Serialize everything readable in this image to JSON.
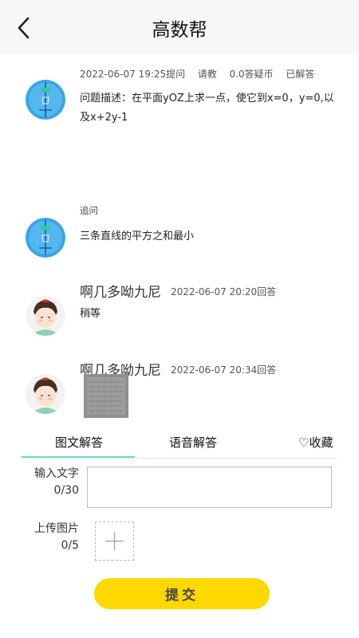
{
  "header": {
    "title": "高数帮"
  },
  "question": {
    "meta_time": "2022-06-07 19:25提问",
    "meta_ask": "请教",
    "meta_coin": "0.0答疑币",
    "meta_status": "已解答",
    "text": "问题描述：在平面yOZ上求一点，使它到x=0，y=0,以及x+2y-1"
  },
  "followup": {
    "label": "追问",
    "text": "三条直线的平方之和最小"
  },
  "answers": [
    {
      "name": "啊几多呦九尼",
      "time": "2022-06-07 20:20回答",
      "text": "稍等"
    },
    {
      "name": "啊几多呦九尼",
      "time": "2022-06-07 20:34回答"
    }
  ],
  "tabs": {
    "text_answer": "图文解答",
    "voice_answer": "语音解答",
    "favorite": "♡收藏"
  },
  "form": {
    "input_label": "输入文字",
    "input_count": "0/30",
    "upload_label": "上传图片",
    "upload_count": "0/5",
    "submit_label": "提交"
  },
  "colors": {
    "accent_tab": "#66ddd1",
    "submit": "#ffd800",
    "header_bg": "#f7f7f7"
  },
  "icons": {
    "back": "chevron-left-icon",
    "plus": "plus-icon"
  }
}
